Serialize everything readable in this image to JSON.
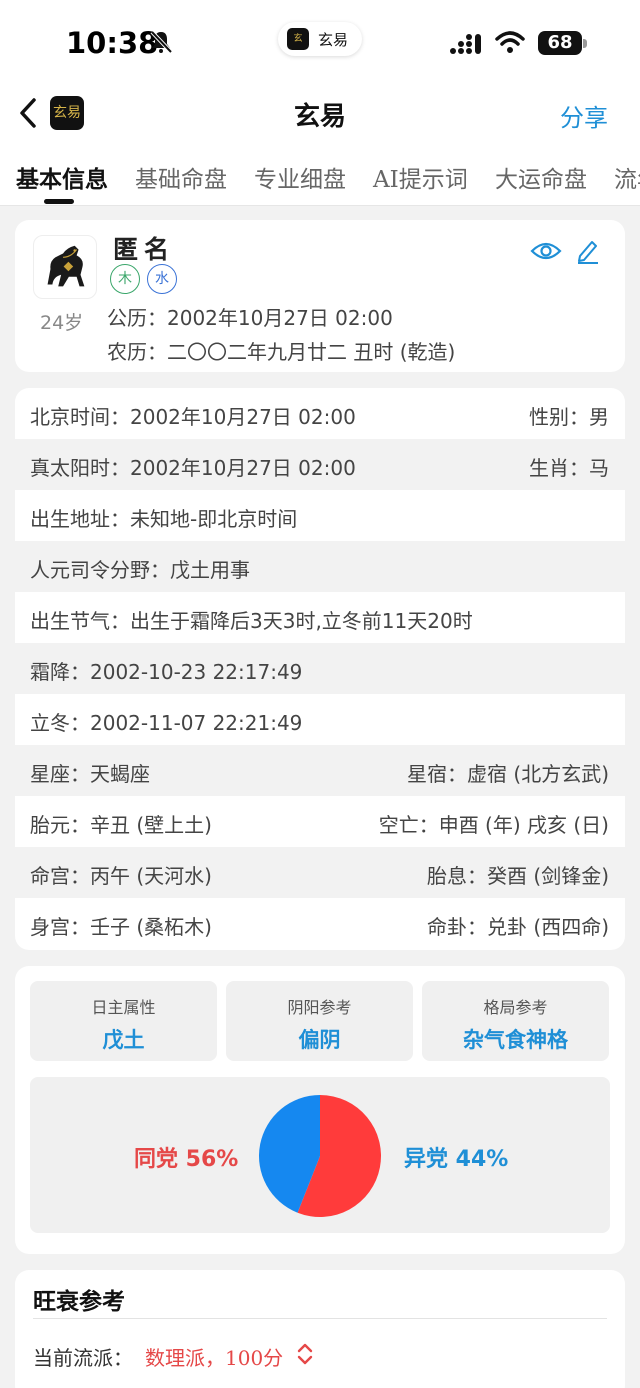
{
  "status_bar": {
    "time": "10:38",
    "island_app": "玄易",
    "battery": "68"
  },
  "nav": {
    "logo_text": "玄易",
    "title": "玄易",
    "share": "分享"
  },
  "tabs": [
    "基本信息",
    "基础命盘",
    "专业细盘",
    "AI提示词",
    "大运命盘",
    "流年"
  ],
  "profile": {
    "name": "匿名",
    "age": "24岁",
    "elements": [
      "木",
      "水"
    ],
    "solar": "公历：2002年10月27日 02:00",
    "lunar": "农历：二〇〇二年九月廿二 丑时 (乾造)"
  },
  "info_rows": [
    {
      "left": "北京时间：2002年10月27日 02:00",
      "right": "性别：男"
    },
    {
      "left": "真太阳时：2002年10月27日 02:00",
      "right": "生肖：马"
    },
    {
      "left": "出生地址：未知地-即北京时间",
      "right": ""
    },
    {
      "left": "人元司令分野：戊土用事",
      "right": ""
    },
    {
      "left": "出生节气：出生于霜降后3天3时,立冬前11天20时",
      "right": ""
    },
    {
      "left": "霜降：2002-10-23 22:17:49",
      "right": ""
    },
    {
      "left": "立冬：2002-11-07 22:21:49",
      "right": ""
    },
    {
      "left": "星座：天蝎座",
      "right": "星宿：虚宿 (北方玄武)"
    },
    {
      "left": "胎元：辛丑 (壁上土)",
      "right": "空亡：申酉 (年) 戌亥 (日)"
    },
    {
      "left": "命宫：丙午 (天河水)",
      "right": "胎息：癸酉 (剑锋金)"
    },
    {
      "left": "身宫：壬子 (桑柘木)",
      "right": "命卦：兑卦 (西四命)"
    }
  ],
  "attributes": [
    {
      "key": "日主属性",
      "value": "戊土"
    },
    {
      "key": "阴阳参考",
      "value": "偏阴"
    },
    {
      "key": "格局参考",
      "value": "杂气食神格"
    }
  ],
  "chart_data": {
    "type": "pie",
    "slices": [
      {
        "label": "同党",
        "value": 56,
        "color": "#ff3b3b",
        "text": "同党 56%"
      },
      {
        "label": "异党",
        "value": 44,
        "color": "#1588f0",
        "text": "异党 44%"
      }
    ]
  },
  "strength": {
    "title": "旺衰参考",
    "school_label": "当前流派：",
    "school_value": "数理派，100分"
  },
  "colors": {
    "accent_blue": "#1f8fd6",
    "accent_red": "#e54848"
  }
}
